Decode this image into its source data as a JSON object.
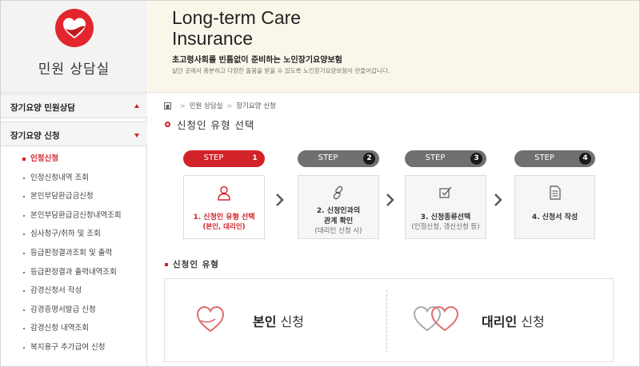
{
  "sidebar": {
    "title": "민원 상담실",
    "sections": [
      {
        "label": "장기요양 민원상담",
        "state": "collapsed"
      },
      {
        "label": "장기요양 신청",
        "state": "expanded"
      }
    ],
    "items": [
      {
        "label": "인정신청",
        "active": true
      },
      {
        "label": "인정신청내역 조회",
        "active": false
      },
      {
        "label": "본인부담환급금신청",
        "active": false
      },
      {
        "label": "본인부담환급금신청내역조회",
        "active": false
      },
      {
        "label": "심사청구/취하 및 조회",
        "active": false
      },
      {
        "label": "등급판정결과조회 및 출력",
        "active": false
      },
      {
        "label": "등급판정결과 출력내역조회",
        "active": false
      },
      {
        "label": "감경신청서 작성",
        "active": false
      },
      {
        "label": "감경증명서발급 신청",
        "active": false
      },
      {
        "label": "감경신청 내역조회",
        "active": false
      },
      {
        "label": "복지용구 추가급여 신청",
        "active": false
      }
    ]
  },
  "banner": {
    "title": "Long-term Care Insurance",
    "subtitle": "초고령사회를 빈틈없이 준비하는 노인장기요양보험",
    "description": "살던 곳에서 충분하고 다양한 돌봄을 받을 수 있도록 노인장기요양보험이 만들어갑니다."
  },
  "breadcrumb": {
    "items": [
      "민원 상담실",
      "장기요양 신청"
    ]
  },
  "page": {
    "title": "신청인 유형 선택"
  },
  "steps": [
    {
      "tab_label": "STEP",
      "number": "1",
      "line1": "1. 신청인 유형 선택",
      "line2": "(본인, 대리인)",
      "icon": "person-icon",
      "active": true
    },
    {
      "tab_label": "STEP",
      "number": "2",
      "line1": "2. 신청인과의",
      "line1b": "관계 확인",
      "line2": "(대리인 신청 시)",
      "icon": "link-icon",
      "active": false
    },
    {
      "tab_label": "STEP",
      "number": "3",
      "line1": "3. 신청종류선택",
      "line2": "(인정신청, 갱신신청 등)",
      "icon": "checkbox-pencil-icon",
      "active": false
    },
    {
      "tab_label": "STEP",
      "number": "4",
      "line1": "4. 신청서 작성",
      "line2": "",
      "icon": "document-icon",
      "active": false
    }
  ],
  "applicant_type": {
    "section_title": "신청인 유형",
    "self": {
      "bold": "본인",
      "rest": " 신청"
    },
    "proxy": {
      "bold": "대리인",
      "rest": " 신청"
    }
  },
  "colors": {
    "accent": "#d2222a",
    "banner_bg": "#fbf6ea",
    "step_gray": "#707070"
  }
}
